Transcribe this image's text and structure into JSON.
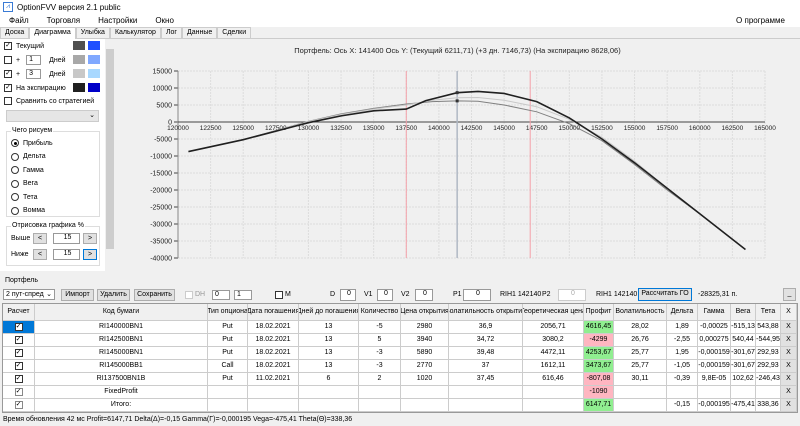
{
  "window": {
    "title": "OptionFVV версия 2.1 public",
    "logo": "chart-app-icon"
  },
  "menu": {
    "items": [
      "Файл",
      "Торговля",
      "Настройки",
      "Окно"
    ],
    "about": "О программе"
  },
  "tabs": [
    {
      "label": "Доска"
    },
    {
      "label": "Диаграмма",
      "active": true
    },
    {
      "label": "Улыбка"
    },
    {
      "label": "Калькулятор"
    },
    {
      "label": "Лог"
    },
    {
      "label": "Данные"
    },
    {
      "label": "Сделки"
    }
  ],
  "left": {
    "current": {
      "label": "Текущий",
      "checked": true,
      "color1": "#505050",
      "color2": "#2050ff"
    },
    "plus1": {
      "plus": "+",
      "days": "1",
      "unit": "Дней",
      "checked": false,
      "color1": "#a8a8a8",
      "color2": "#80a8ff"
    },
    "plus3": {
      "plus": "+",
      "days": "3",
      "unit": "Дней",
      "checked": true,
      "color1": "#c8c8c8",
      "color2": "#a8d8ff"
    },
    "expiry": {
      "label": "На экспирацию",
      "checked": true,
      "color1": "#202020",
      "color2": "#0000c8"
    },
    "compare": {
      "label": "Сравнить со стратегией",
      "checked": false
    },
    "what_group": "Чего рисуем",
    "radios": [
      {
        "label": "Прибыль",
        "on": true
      },
      {
        "label": "Дельта"
      },
      {
        "label": "Гамма"
      },
      {
        "label": "Вега"
      },
      {
        "label": "Тета"
      },
      {
        "label": "Вомма"
      }
    ],
    "draw_group": "Отрисовка графика %",
    "above": {
      "label": "Выше",
      "value": "15",
      "dec": "<",
      "inc": ">"
    },
    "below": {
      "label": "Ниже",
      "value": "15",
      "dec": "<",
      "inc": ">"
    }
  },
  "chart_data": {
    "type": "line",
    "title": "Портфель:  Ось X:  141400  Ось Y:   (Текущий 6211,71)  (+3 дн. 7146,73)  (На экспирацию 8628,06)",
    "xlim": [
      120000,
      165000
    ],
    "ylim": [
      -40000,
      15000
    ],
    "xticks": [
      120000,
      122500,
      125000,
      127500,
      130000,
      132500,
      135000,
      137500,
      140000,
      142500,
      145000,
      147500,
      150000,
      152500,
      155000,
      157500,
      160000,
      162500,
      165000
    ],
    "yticks": [
      15000,
      10000,
      5000,
      0,
      -5000,
      -10000,
      -15000,
      -20000,
      -25000,
      -30000,
      -35000,
      -40000
    ],
    "grid": true,
    "cursor_x": 141400,
    "strike_lines": [
      137500,
      147000
    ],
    "series": [
      {
        "name": "На экспирацию",
        "color": "#202020",
        "width": 1.6,
        "points": [
          [
            120800,
            -8700
          ],
          [
            125000,
            -5200
          ],
          [
            130000,
            -200
          ],
          [
            132500,
            1800
          ],
          [
            135000,
            3300
          ],
          [
            137500,
            3800
          ],
          [
            139000,
            6300
          ],
          [
            141400,
            8628
          ],
          [
            143000,
            9000
          ],
          [
            145000,
            8400
          ],
          [
            147500,
            6000
          ],
          [
            150000,
            1200
          ],
          [
            152500,
            -5000
          ],
          [
            155000,
            -12000
          ],
          [
            157500,
            -19500
          ],
          [
            160000,
            -27000
          ],
          [
            163500,
            -37500
          ]
        ]
      },
      {
        "name": "+3 дн.",
        "color": "#c8c8c8",
        "width": 1,
        "points": [
          [
            120800,
            -8700
          ],
          [
            125000,
            -5200
          ],
          [
            130000,
            100
          ],
          [
            132500,
            2200
          ],
          [
            135000,
            3800
          ],
          [
            137500,
            5000
          ],
          [
            139500,
            6400
          ],
          [
            141400,
            7147
          ],
          [
            143000,
            7200
          ],
          [
            145000,
            6400
          ],
          [
            147500,
            4500
          ],
          [
            150000,
            800
          ],
          [
            152500,
            -4500
          ],
          [
            155000,
            -11500
          ],
          [
            157500,
            -19500
          ],
          [
            160000,
            -27000
          ],
          [
            163500,
            -37500
          ]
        ]
      },
      {
        "name": "Текущий",
        "color": "#808080",
        "width": 1,
        "points": [
          [
            120800,
            -8700
          ],
          [
            125000,
            -5200
          ],
          [
            130000,
            200
          ],
          [
            132500,
            2400
          ],
          [
            135000,
            4000
          ],
          [
            137500,
            5300
          ],
          [
            139500,
            6000
          ],
          [
            141400,
            6212
          ],
          [
            143000,
            6100
          ],
          [
            145000,
            5000
          ],
          [
            147500,
            3000
          ],
          [
            150000,
            -500
          ],
          [
            152500,
            -5500
          ],
          [
            155000,
            -12500
          ],
          [
            157500,
            -20000
          ],
          [
            160000,
            -27000
          ],
          [
            163500,
            -37500
          ]
        ]
      }
    ]
  },
  "portfolio": {
    "group": "Портфель",
    "strategy": "2 пут-спред",
    "import": "Импорт",
    "delete": "Удалить",
    "save": "Сохранить",
    "dh_label": "DH",
    "dh_v1": "0",
    "dh_v2": "1",
    "m_label": "M",
    "d_label": "D",
    "d": "0",
    "v1_label": "V1",
    "v1": "0",
    "v2_label": "V2",
    "v2": "0",
    "p1_label": "P1",
    "p1": "0",
    "p1_info": "RIH1 142140",
    "p2_label": "P2",
    "p2": "0",
    "p2_info": "RIH1 142140",
    "calc": "Рассчитать ГО",
    "go_value": "-28325,31 п.",
    "minimize": "_"
  },
  "table": {
    "headers": [
      "Расчет",
      "Код бумаги",
      "Тип опциона",
      "Дата погашения",
      "Дней до погашения",
      "Количество",
      "Цена открытия",
      "Волатильность открытия",
      "Теоретическая цена",
      "Профит",
      "Волатильность",
      "Дельта",
      "Гамма",
      "Вега",
      "Тета",
      "X"
    ],
    "rows": [
      {
        "code": "RI140000BN1",
        "type": "Put",
        "date": "18.02.2021",
        "days": "13",
        "qty": "-5",
        "price": "2980",
        "vol_open": "36,9",
        "theo": "2056,71",
        "profit": "4616,45",
        "pos": true,
        "vol": "28,02",
        "delta": "1,89",
        "gamma": "-0,00025",
        "vega": "-515,13",
        "theta": "543,88",
        "x": "X"
      },
      {
        "code": "RI142500BN1",
        "type": "Put",
        "date": "18.02.2021",
        "days": "13",
        "qty": "5",
        "price": "3940",
        "vol_open": "34,72",
        "theo": "3080,2",
        "profit": "-4299",
        "pos": false,
        "vol": "26,76",
        "delta": "-2,55",
        "gamma": "0,000275",
        "vega": "540,44",
        "theta": "-544,95",
        "x": "X"
      },
      {
        "code": "RI145000BN1",
        "type": "Put",
        "date": "18.02.2021",
        "days": "13",
        "qty": "-3",
        "price": "5890",
        "vol_open": "39,48",
        "theo": "4472,11",
        "profit": "4253,67",
        "pos": true,
        "vol": "25,77",
        "delta": "1,95",
        "gamma": "-0,000159",
        "vega": "-301,67",
        "theta": "292,93",
        "x": "X"
      },
      {
        "code": "RI145000BB1",
        "type": "Call",
        "date": "18.02.2021",
        "days": "13",
        "qty": "-3",
        "price": "2770",
        "vol_open": "37",
        "theo": "1612,11",
        "profit": "3473,67",
        "pos": true,
        "vol": "25,77",
        "delta": "-1,05",
        "gamma": "-0,000159",
        "vega": "-301,67",
        "theta": "292,93",
        "x": "X"
      },
      {
        "code": "RI137500BN1B",
        "type": "Put",
        "date": "11.02.2021",
        "days": "6",
        "qty": "2",
        "price": "1020",
        "vol_open": "37,45",
        "theo": "616,46",
        "profit": "-807,08",
        "pos": false,
        "vol": "30,11",
        "delta": "-0,39",
        "gamma": "9,8E-05",
        "vega": "102,62",
        "theta": "-246,43",
        "x": "X"
      },
      {
        "code": "FixedProfit",
        "profit": "-1090",
        "pos": false,
        "x": "X"
      },
      {
        "code": "Итого:",
        "profit": "6147,71",
        "pos": true,
        "delta": "-0,15",
        "gamma": "-0,000195",
        "vega": "-475,41",
        "theta": "338,36",
        "x": "X"
      }
    ]
  },
  "status": "Время обновления 42 мс  Profit=6147,71 Delta(Δ)=-0,15 Gamma(Γ)=-0,000195 Vega=-475,41 Theta(Θ)=338,36"
}
